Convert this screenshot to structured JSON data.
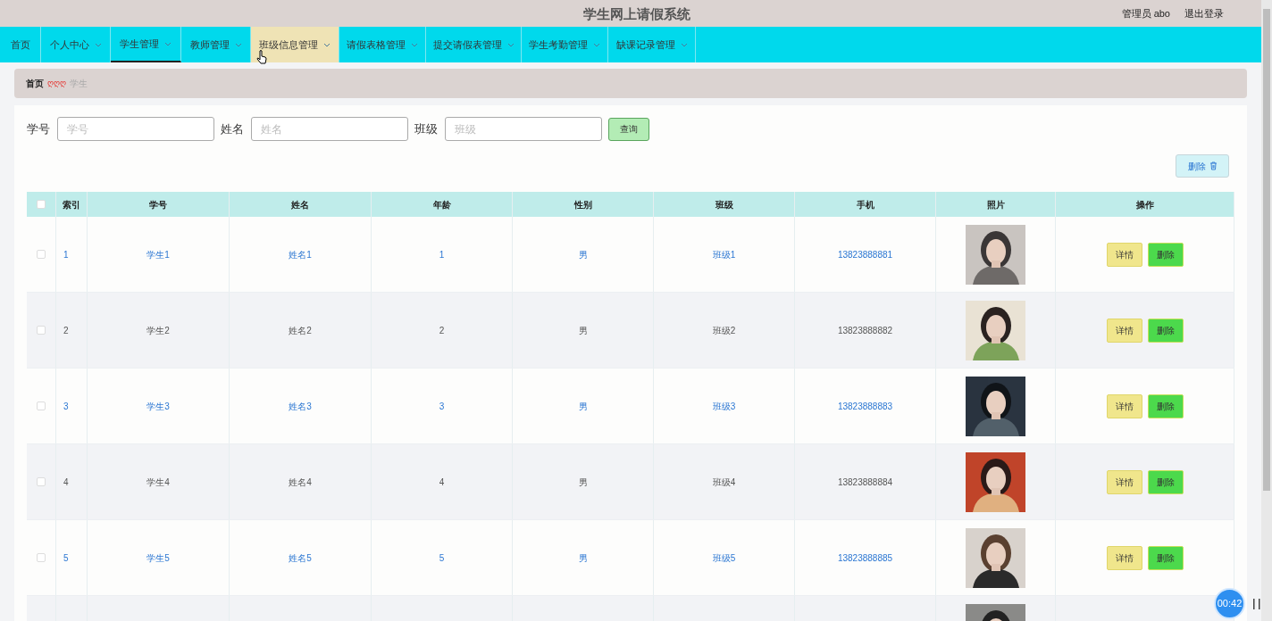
{
  "header": {
    "title": "学生网上请假系统",
    "user": "管理员 abo",
    "logout": "退出登录"
  },
  "nav": [
    {
      "label": "首页",
      "dropdown": false,
      "selected": false,
      "hovered": false
    },
    {
      "label": "个人中心",
      "dropdown": true,
      "selected": false,
      "hovered": false
    },
    {
      "label": "学生管理",
      "dropdown": true,
      "selected": true,
      "hovered": false
    },
    {
      "label": "教师管理",
      "dropdown": true,
      "selected": false,
      "hovered": false
    },
    {
      "label": "班级信息管理",
      "dropdown": true,
      "selected": false,
      "hovered": true
    },
    {
      "label": "请假表格管理",
      "dropdown": true,
      "selected": false,
      "hovered": false
    },
    {
      "label": "提交请假表管理",
      "dropdown": true,
      "selected": false,
      "hovered": false
    },
    {
      "label": "学生考勤管理",
      "dropdown": true,
      "selected": false,
      "hovered": false
    },
    {
      "label": "缺课记录管理",
      "dropdown": true,
      "selected": false,
      "hovered": false
    }
  ],
  "breadcrumb": {
    "home": "首页",
    "separator": "ღღღ",
    "current": "学生"
  },
  "search": [
    {
      "label": "学号",
      "placeholder": "学号"
    },
    {
      "label": "姓名",
      "placeholder": "姓名"
    },
    {
      "label": "班级",
      "placeholder": "班级"
    }
  ],
  "search_button": "查询",
  "bulk_delete": "删除",
  "table": {
    "columns": [
      "索引",
      "学号",
      "姓名",
      "年龄",
      "性别",
      "班级",
      "手机",
      "照片",
      "操作"
    ],
    "select_all": {
      "checked": false
    },
    "rows": [
      {
        "checked": false,
        "highlighted": true,
        "cells": [
          "1",
          "学生1",
          "姓名1",
          "1",
          "男",
          "班级1",
          "13823888881"
        ],
        "photo": {
          "kind": "picture"
        },
        "actions": [
          "详情",
          "删除"
        ]
      },
      {
        "checked": false,
        "highlighted": false,
        "cells": [
          "2",
          "学生2",
          "姓名2",
          "2",
          "男",
          "班级2",
          "13823888882"
        ],
        "photo": {
          "kind": "picture"
        },
        "actions": [
          "详情",
          "删除"
        ]
      },
      {
        "checked": false,
        "highlighted": true,
        "cells": [
          "3",
          "学生3",
          "姓名3",
          "3",
          "男",
          "班级3",
          "13823888883"
        ],
        "photo": {
          "kind": "picture"
        },
        "actions": [
          "详情",
          "删除"
        ]
      },
      {
        "checked": false,
        "highlighted": false,
        "cells": [
          "4",
          "学生4",
          "姓名4",
          "4",
          "男",
          "班级4",
          "13823888884"
        ],
        "photo": {
          "kind": "picture"
        },
        "actions": [
          "详情",
          "删除"
        ]
      },
      {
        "checked": false,
        "highlighted": true,
        "cells": [
          "5",
          "学生5",
          "姓名5",
          "5",
          "男",
          "班级5",
          "13823888885"
        ],
        "photo": {
          "kind": "picture"
        },
        "actions": [
          "详情",
          "删除"
        ]
      },
      {
        "photo": {
          "kind": "picture"
        }
      }
    ]
  },
  "recorder": {
    "time": "00:42"
  }
}
